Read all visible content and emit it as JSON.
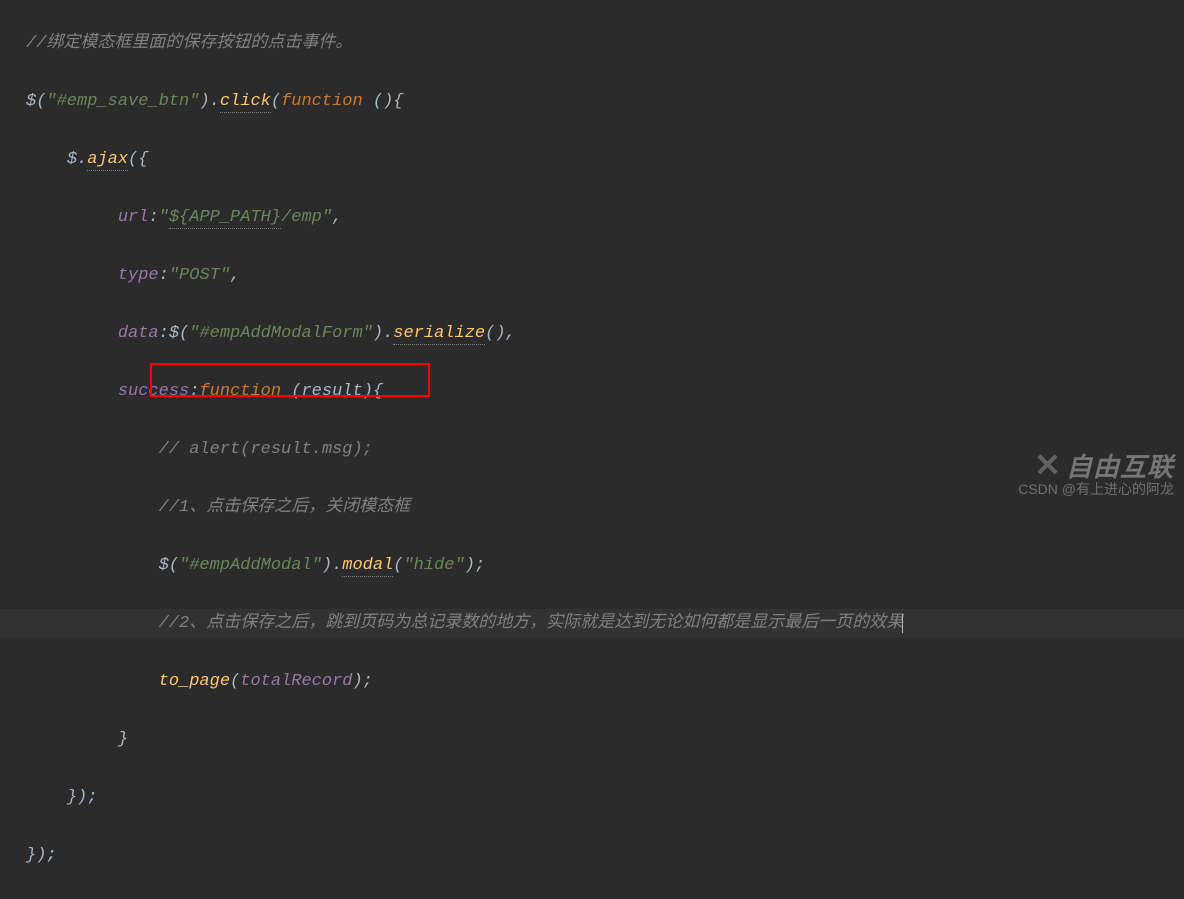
{
  "code": {
    "line1_comment": "//绑定模态框里面的保存按钮的点击事件。",
    "line2_jq": "$(",
    "line2_sel": "\"#emp_save_btn\"",
    "line2_paren": ").",
    "line2_click": "click",
    "line2_func": "(",
    "line2_function_kw": "function ",
    "line2_end": "(){",
    "line3_ajax": "$.",
    "line3_ajax_fn": "ajax",
    "line3_ajax_end": "({",
    "line4_url_key": "url",
    "line4_colon": ":",
    "line4_url_q1": "\"",
    "line4_url_app": "${APP_PATH}",
    "line4_url_emp": "/emp",
    "line4_url_q2": "\"",
    "line4_end": ",",
    "line5_type_key": "type",
    "line5_colon": ":",
    "line5_type_val": "\"POST\"",
    "line5_end": ",",
    "line6_data_key": "data",
    "line6_colon": ":$(",
    "line6_sel": "\"#empAddModalForm\"",
    "line6_paren": ").",
    "line6_serialize": "serialize",
    "line6_end": "(),",
    "line7_success_key": "success",
    "line7_colon": ":",
    "line7_function_kw": "function ",
    "line7_params": "(result){",
    "line8_comment": "// alert(result.msg);",
    "line9_comment": "//1、点击保存之后，关闭模态框",
    "line10_jq": "$(",
    "line10_sel": "\"#empAddModal\"",
    "line10_paren": ").",
    "line10_modal": "modal",
    "line10_paren2": "(",
    "line10_hide": "\"hide\"",
    "line10_end": ");",
    "line11_comment": "//2、点击保存之后，跳到页码为总记录数的地方，实际就是达到无论如何都是显示最后一页的效果",
    "line12_fn": "to_page",
    "line12_paren": "(",
    "line12_var": "totalRecord",
    "line12_end": ");",
    "line13_brace": "}",
    "line14_end": "});",
    "line15_end": "});"
  },
  "watermark": {
    "logo": "自由互联",
    "text": "CSDN @有上进心的阿龙"
  }
}
